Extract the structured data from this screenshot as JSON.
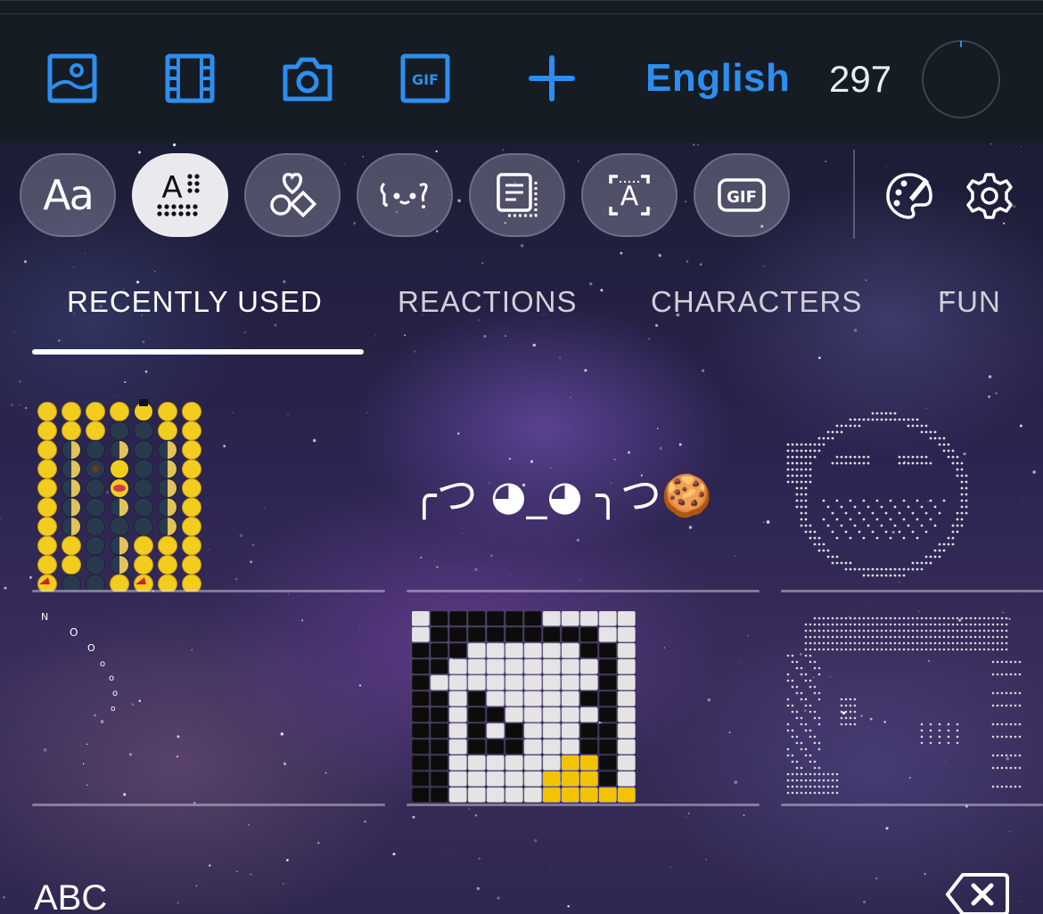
{
  "toolbar": {
    "icons": [
      "image-icon",
      "film-icon",
      "camera-icon",
      "gif-icon",
      "plus-icon"
    ],
    "language": "English",
    "char_count": "297",
    "accent_color": "#2d8ef0"
  },
  "categories": [
    {
      "name": "fonts",
      "label": "Aa",
      "active": false
    },
    {
      "name": "text-art",
      "label": "A",
      "active": true
    },
    {
      "name": "emoji-art",
      "label": "",
      "active": false
    },
    {
      "name": "kaomoji",
      "label": "",
      "active": false
    },
    {
      "name": "templates",
      "label": "",
      "active": false
    },
    {
      "name": "text-effects",
      "label": "A",
      "active": false
    },
    {
      "name": "gif",
      "label": "GIF",
      "active": false
    }
  ],
  "tools": [
    "palette-icon",
    "settings-icon"
  ],
  "tabs": [
    {
      "label": "RECENTLY USED",
      "active": true
    },
    {
      "label": "REACTIONS",
      "active": false
    },
    {
      "label": "CHARACTERS",
      "active": false
    },
    {
      "label": "FUN",
      "active": false
    }
  ],
  "cards": {
    "kaomoji": "╭つ ◕_◕ ╮つ🍪"
  },
  "bottom": {
    "abc_label": "ABC"
  }
}
